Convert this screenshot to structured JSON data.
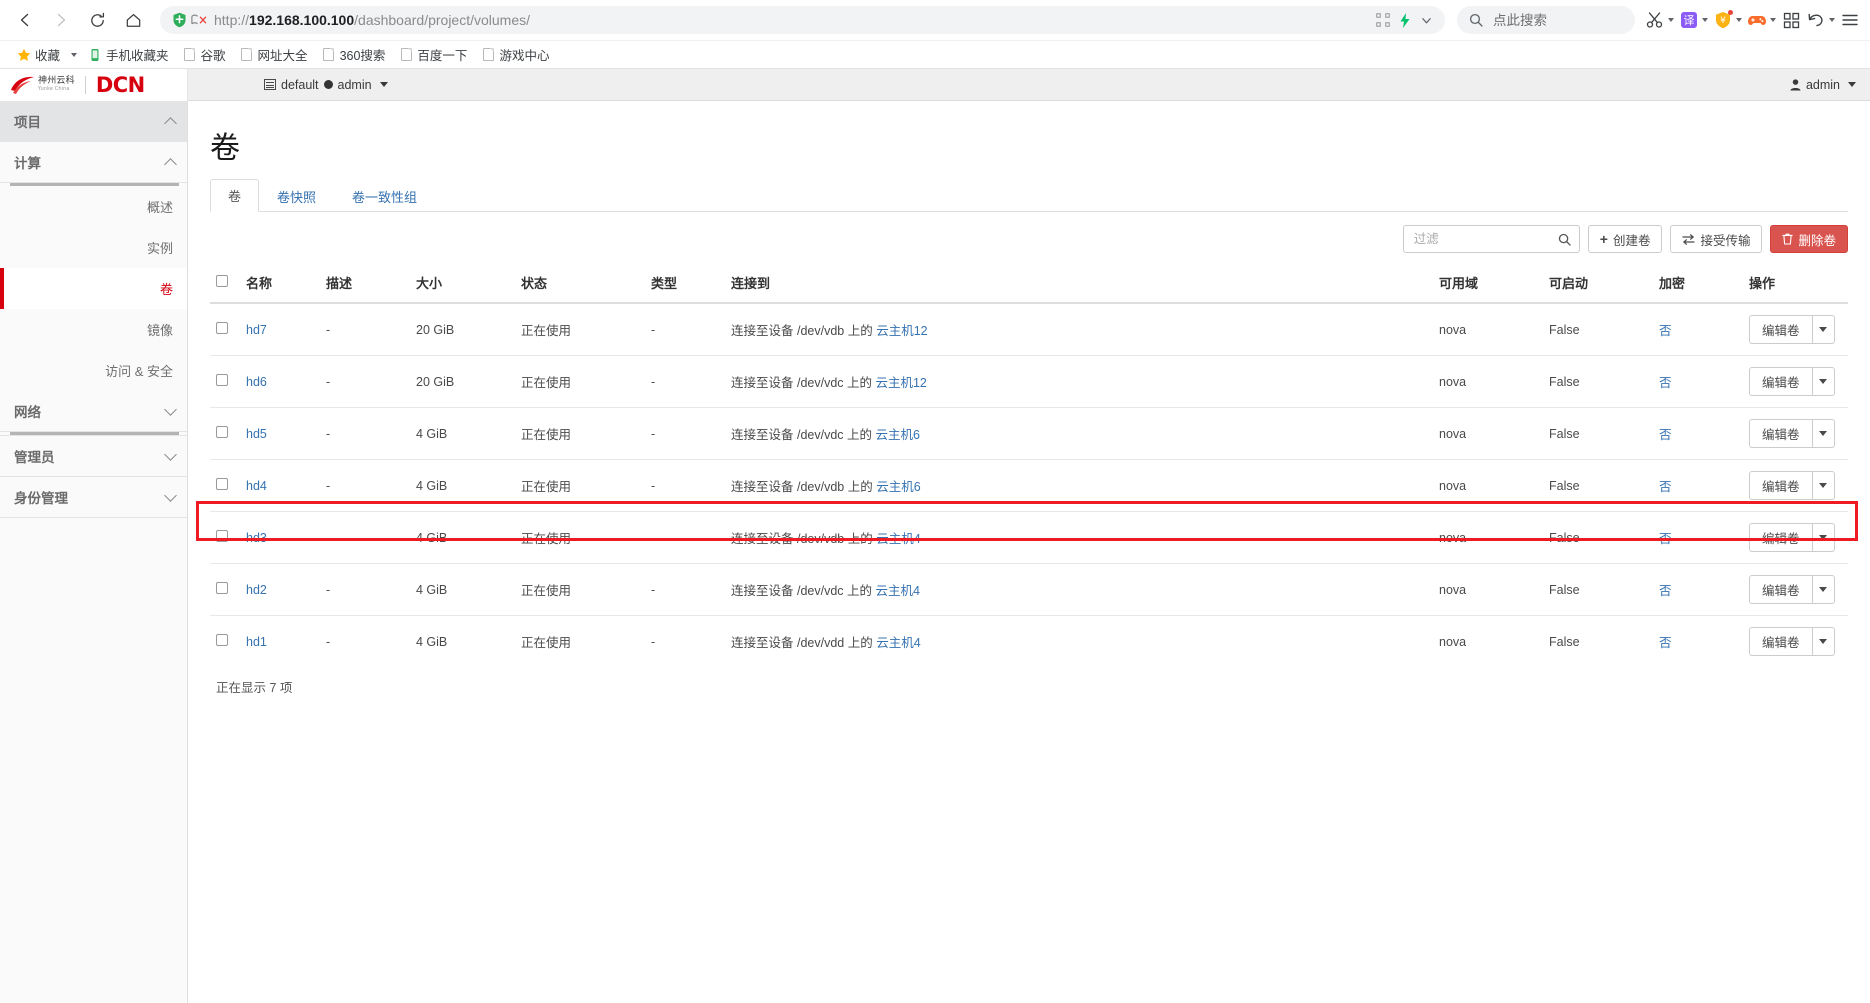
{
  "browser": {
    "nav": {
      "back_icon": "back-arrow-icon",
      "forward_icon": "forward-arrow-icon",
      "reload_icon": "reload-icon",
      "home_icon": "home-icon"
    },
    "url": {
      "scheme": "http://",
      "host": "192.168.100.100",
      "path": "/dashboard/project/volumes/",
      "full": "http://192.168.100.100/dashboard/project/volumes/",
      "shield_icon": "security-shield-icon",
      "cert_icon": "certificate-warning-icon",
      "qr_icon": "qr-code-icon",
      "bolt_icon": "lightning-bolt-icon",
      "chevron_icon": "chevron-down-icon"
    },
    "search": {
      "placeholder": "点此搜索",
      "value": "",
      "icon": "search-icon"
    },
    "extensions": [
      {
        "name": "scissors-icon",
        "label": "截图"
      },
      {
        "name": "translate-icon",
        "label": "译"
      },
      {
        "name": "shield-money-icon",
        "label": "安全"
      },
      {
        "name": "game-controller-icon",
        "label": "游戏"
      },
      {
        "name": "apps-grid-icon",
        "label": "应用"
      },
      {
        "name": "undo-icon",
        "label": "撤销"
      },
      {
        "name": "menu-icon",
        "label": "菜单"
      }
    ],
    "bookmarks": [
      {
        "label": "收藏",
        "icon": "star-icon",
        "caret": true
      },
      {
        "label": "手机收藏夹",
        "icon": "phone-icon",
        "caret": false
      },
      {
        "label": "谷歌",
        "icon": "page-icon",
        "caret": false
      },
      {
        "label": "网址大全",
        "icon": "page-icon",
        "caret": false
      },
      {
        "label": "360搜索",
        "icon": "page-icon",
        "caret": false
      },
      {
        "label": "百度一下",
        "icon": "page-icon",
        "caret": false
      },
      {
        "label": "游戏中心",
        "icon": "page-icon",
        "caret": false
      }
    ]
  },
  "dashboard_header": {
    "brand_cn_line1": "神州云科",
    "brand_cn_line2": "Yunke China",
    "brand_dcn": "DCN",
    "context": {
      "project_icon": "project-list-icon",
      "project": "default",
      "separator_icon": "dot-separator-icon",
      "user": "admin",
      "caret_icon": "caret-down-icon"
    },
    "user_menu": {
      "icon": "user-icon",
      "label": "admin",
      "caret_icon": "caret-down-icon"
    }
  },
  "sidebar": {
    "groups": [
      {
        "label": "项目",
        "level": 1,
        "chevron": "chevron-up-icon",
        "underline": false,
        "items": []
      },
      {
        "label": "计算",
        "level": 2,
        "chevron": "chevron-up-icon",
        "underline": true,
        "items": [
          {
            "label": "概述",
            "active": false
          },
          {
            "label": "实例",
            "active": false
          },
          {
            "label": "卷",
            "active": true
          },
          {
            "label": "镜像",
            "active": false
          },
          {
            "label": "访问 & 安全",
            "active": false
          }
        ]
      },
      {
        "label": "网络",
        "level": 2,
        "chevron": "chevron-down-icon",
        "underline": true,
        "items": []
      },
      {
        "label": "管理员",
        "level": 2,
        "chevron": "chevron-down-icon",
        "underline": false,
        "items": []
      },
      {
        "label": "身份管理",
        "level": 2,
        "chevron": "chevron-down-icon",
        "underline": false,
        "items": []
      }
    ]
  },
  "main": {
    "page_title": "卷",
    "tabs": [
      {
        "label": "卷",
        "active": true
      },
      {
        "label": "卷快照",
        "active": false
      },
      {
        "label": "卷一致性组",
        "active": false
      }
    ],
    "toolbar": {
      "filter_placeholder": "过滤",
      "filter_value": "",
      "filter_icon": "search-icon",
      "create_label": "创建卷",
      "create_icon": "plus-icon",
      "transfer_label": "接受传输",
      "transfer_icon": "transfer-arrows-icon",
      "delete_label": "删除卷",
      "delete_icon": "trash-icon"
    },
    "table": {
      "columns": [
        "",
        "名称",
        "描述",
        "大小",
        "状态",
        "类型",
        "连接到",
        "可用域",
        "可启动",
        "加密",
        "操作"
      ],
      "rows": [
        {
          "name": "hd7",
          "description": "-",
          "size": "20 GiB",
          "status": "正在使用",
          "type": "-",
          "attached_prefix": "连接至设备 /dev/vdb 上的",
          "attached_link": "云主机12",
          "zone": "nova",
          "bootable": "False",
          "encrypted": "否",
          "action_label": "编辑卷",
          "highlighted": false
        },
        {
          "name": "hd6",
          "description": "-",
          "size": "20 GiB",
          "status": "正在使用",
          "type": "-",
          "attached_prefix": "连接至设备 /dev/vdc 上的",
          "attached_link": "云主机12",
          "zone": "nova",
          "bootable": "False",
          "encrypted": "否",
          "action_label": "编辑卷",
          "highlighted": false
        },
        {
          "name": "hd5",
          "description": "-",
          "size": "4 GiB",
          "status": "正在使用",
          "type": "-",
          "attached_prefix": "连接至设备 /dev/vdc 上的",
          "attached_link": "云主机6",
          "zone": "nova",
          "bootable": "False",
          "encrypted": "否",
          "action_label": "编辑卷",
          "highlighted": false
        },
        {
          "name": "hd4",
          "description": "-",
          "size": "4 GiB",
          "status": "正在使用",
          "type": "-",
          "attached_prefix": "连接至设备 /dev/vdb 上的",
          "attached_link": "云主机6",
          "zone": "nova",
          "bootable": "False",
          "encrypted": "否",
          "action_label": "编辑卷",
          "highlighted": false
        },
        {
          "name": "hd3",
          "description": "-",
          "size": "4 GiB",
          "status": "正在使用",
          "type": "-",
          "attached_prefix": "连接至设备 /dev/vdb 上的",
          "attached_link": "云主机4",
          "zone": "nova",
          "bootable": "False",
          "encrypted": "否",
          "action_label": "编辑卷",
          "highlighted": false
        },
        {
          "name": "hd2",
          "description": "-",
          "size": "4 GiB",
          "status": "正在使用",
          "type": "-",
          "attached_prefix": "连接至设备 /dev/vdc 上的",
          "attached_link": "云主机4",
          "zone": "nova",
          "bootable": "False",
          "encrypted": "否",
          "action_label": "编辑卷",
          "highlighted": false
        },
        {
          "name": "hd1",
          "description": "-",
          "size": "4 GiB",
          "status": "正在使用",
          "type": "-",
          "attached_prefix": "连接至设备 /dev/vdd 上的",
          "attached_link": "云主机4",
          "zone": "nova",
          "bootable": "False",
          "encrypted": "否",
          "action_label": "编辑卷",
          "highlighted": true
        }
      ],
      "count_text": "正在显示 7 项"
    }
  },
  "colors": {
    "brand_red": "#d6000f",
    "link_blue": "#3572b0",
    "danger": "#d9534f",
    "highlight_border": "#ee1c22"
  }
}
